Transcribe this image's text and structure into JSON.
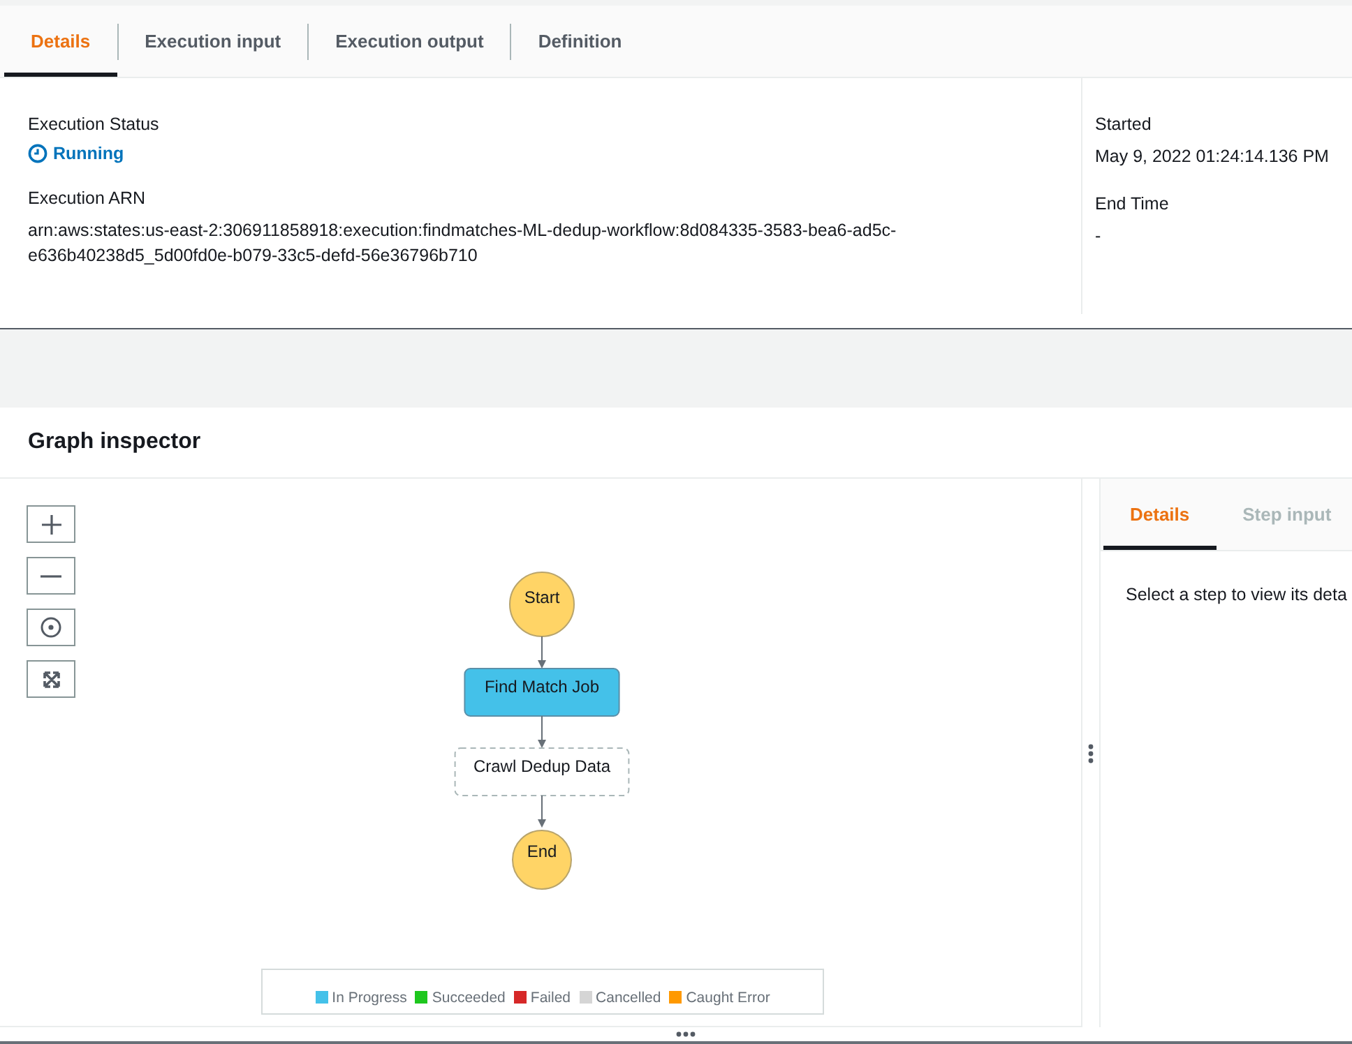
{
  "tabs": [
    {
      "label": "Details",
      "selected": true
    },
    {
      "label": "Execution input",
      "selected": false
    },
    {
      "label": "Execution output",
      "selected": false
    },
    {
      "label": "Definition",
      "selected": false
    }
  ],
  "summary": {
    "fields": [
      {
        "label": "Execution Status",
        "value": "Running",
        "kind": "status"
      },
      {
        "label": "Execution ARN",
        "value": "arn:aws:states:us-east-2:306911858918:execution:findmatches-ML-dedup-workflow:8d084335-3583-bea6-ad5c-e636b40238d5_5d00fd0e-b079-33c5-defd-56e36796b710",
        "kind": "text"
      }
    ],
    "side_fields": [
      {
        "label": "Started",
        "value": "May 9, 2022 01:24:14.136 PM"
      },
      {
        "label": "End Time",
        "value": "-"
      }
    ]
  },
  "graph_inspector": {
    "title": "Graph inspector",
    "nodes": [
      {
        "label": "Start",
        "kind": "terminal"
      },
      {
        "label": "Find Match Job",
        "kind": "running"
      },
      {
        "label": "Crawl Dedup Data",
        "kind": "pending"
      },
      {
        "label": "End",
        "kind": "terminal"
      }
    ],
    "legend": [
      {
        "label": "In Progress",
        "color": "#44c1e9"
      },
      {
        "label": "Succeeded",
        "color": "#1ec71e"
      },
      {
        "label": "Failed",
        "color": "#d62828"
      },
      {
        "label": "Cancelled",
        "color": "#d5d5d5"
      },
      {
        "label": "Caught Error",
        "color": "#ff9900"
      }
    ],
    "step_panel": {
      "tabs": [
        {
          "label": "Details",
          "selected": true,
          "disabled": false
        },
        {
          "label": "Step input",
          "selected": false,
          "disabled": true
        }
      ],
      "message": "Select a step to view its deta"
    }
  }
}
